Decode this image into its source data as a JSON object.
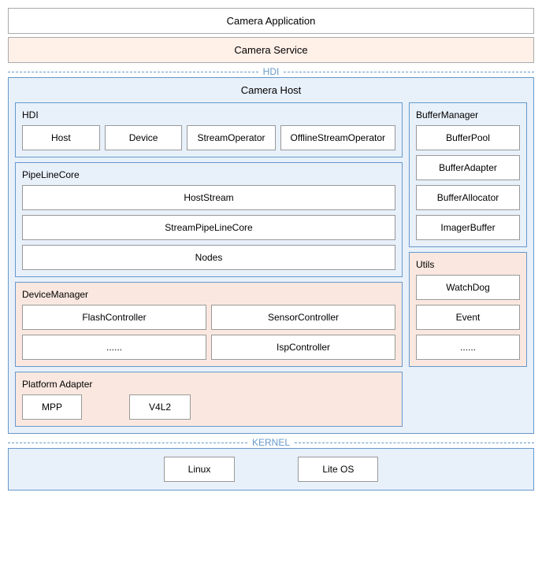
{
  "camera_app": {
    "label": "Camera Application"
  },
  "camera_service": {
    "label": "Camera Service"
  },
  "hdi_divider": {
    "label": "HDI"
  },
  "camera_host": {
    "title": "Camera Host",
    "hdi_section": {
      "title": "HDI",
      "items": [
        "Host",
        "Device",
        "StreamOperator",
        "OfflineStreamOperator"
      ]
    },
    "pipeline_section": {
      "title": "PipeLineCore",
      "items": [
        "HostStream",
        "StreamPipeLineCore",
        "Nodes"
      ]
    },
    "device_section": {
      "title": "DeviceManager",
      "items": [
        "FlashController",
        "SensorController",
        "......",
        "IspController"
      ]
    },
    "platform_section": {
      "title": "Platform Adapter",
      "items": [
        "MPP",
        "V4L2"
      ]
    },
    "buffer_manager_section": {
      "title": "BufferManager",
      "items": [
        "BufferPool",
        "BufferAdapter",
        "BufferAllocator",
        "ImagerBuffer"
      ]
    },
    "utils_section": {
      "title": "Utils",
      "items": [
        "WatchDog",
        "Event",
        "......"
      ]
    }
  },
  "kernel_divider": {
    "label": "KERNEL"
  },
  "kernel": {
    "items": [
      "Linux",
      "Lite OS"
    ]
  }
}
